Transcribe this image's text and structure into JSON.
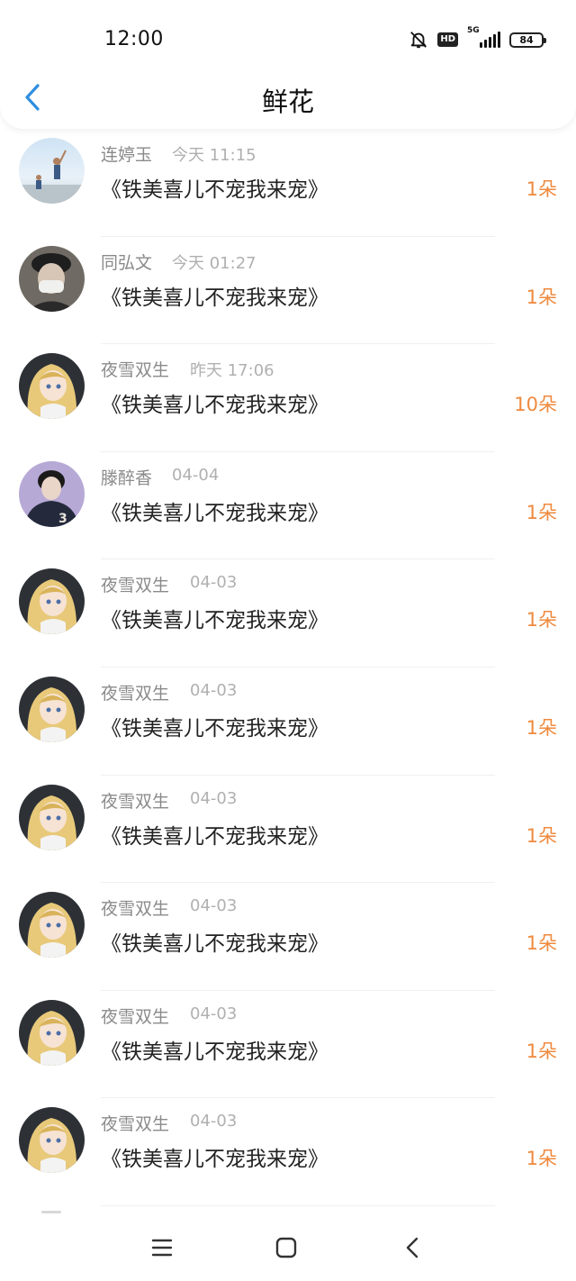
{
  "status_bar": {
    "time": "12:00",
    "network": "5G",
    "hd_label": "HD",
    "battery": "84",
    "icons": [
      "bell-off-icon",
      "hd-icon",
      "signal-icon",
      "battery-icon"
    ]
  },
  "header": {
    "title": "鲜花",
    "back_icon": "chevron-left-icon",
    "accent_color": "#2f8ee0"
  },
  "list": {
    "count_color": "#ef8a3e",
    "items": [
      {
        "name": "连婷玉",
        "time": "今天 11:15",
        "title": "《铁美喜儿不宠我来宠》",
        "count": "1朵",
        "avatar": "beach-photo-avatar"
      },
      {
        "name": "同弘文",
        "time": "今天 01:27",
        "title": "《铁美喜儿不宠我来宠》",
        "count": "1朵",
        "avatar": "masked-man-avatar"
      },
      {
        "name": "夜雪双生",
        "time": "昨天 17:06",
        "title": "《铁美喜儿不宠我来宠》",
        "count": "10朵",
        "avatar": "anime-girl-avatar"
      },
      {
        "name": "滕醉香",
        "time": "04-04",
        "title": "《铁美喜儿不宠我来宠》",
        "count": "1朵",
        "avatar": "varsity-jacket-avatar"
      },
      {
        "name": "夜雪双生",
        "time": "04-03",
        "title": "《铁美喜儿不宠我来宠》",
        "count": "1朵",
        "avatar": "anime-girl-avatar"
      },
      {
        "name": "夜雪双生",
        "time": "04-03",
        "title": "《铁美喜儿不宠我来宠》",
        "count": "1朵",
        "avatar": "anime-girl-avatar"
      },
      {
        "name": "夜雪双生",
        "time": "04-03",
        "title": "《铁美喜儿不宠我来宠》",
        "count": "1朵",
        "avatar": "anime-girl-avatar"
      },
      {
        "name": "夜雪双生",
        "time": "04-03",
        "title": "《铁美喜儿不宠我来宠》",
        "count": "1朵",
        "avatar": "anime-girl-avatar"
      },
      {
        "name": "夜雪双生",
        "time": "04-03",
        "title": "《铁美喜儿不宠我来宠》",
        "count": "1朵",
        "avatar": "anime-girl-avatar"
      },
      {
        "name": "夜雪双生",
        "time": "04-03",
        "title": "《铁美喜儿不宠我来宠》",
        "count": "1朵",
        "avatar": "anime-girl-avatar"
      }
    ]
  },
  "bottom_nav": {
    "buttons": [
      "menu-icon",
      "home-square-icon",
      "back-triangle-icon"
    ]
  }
}
